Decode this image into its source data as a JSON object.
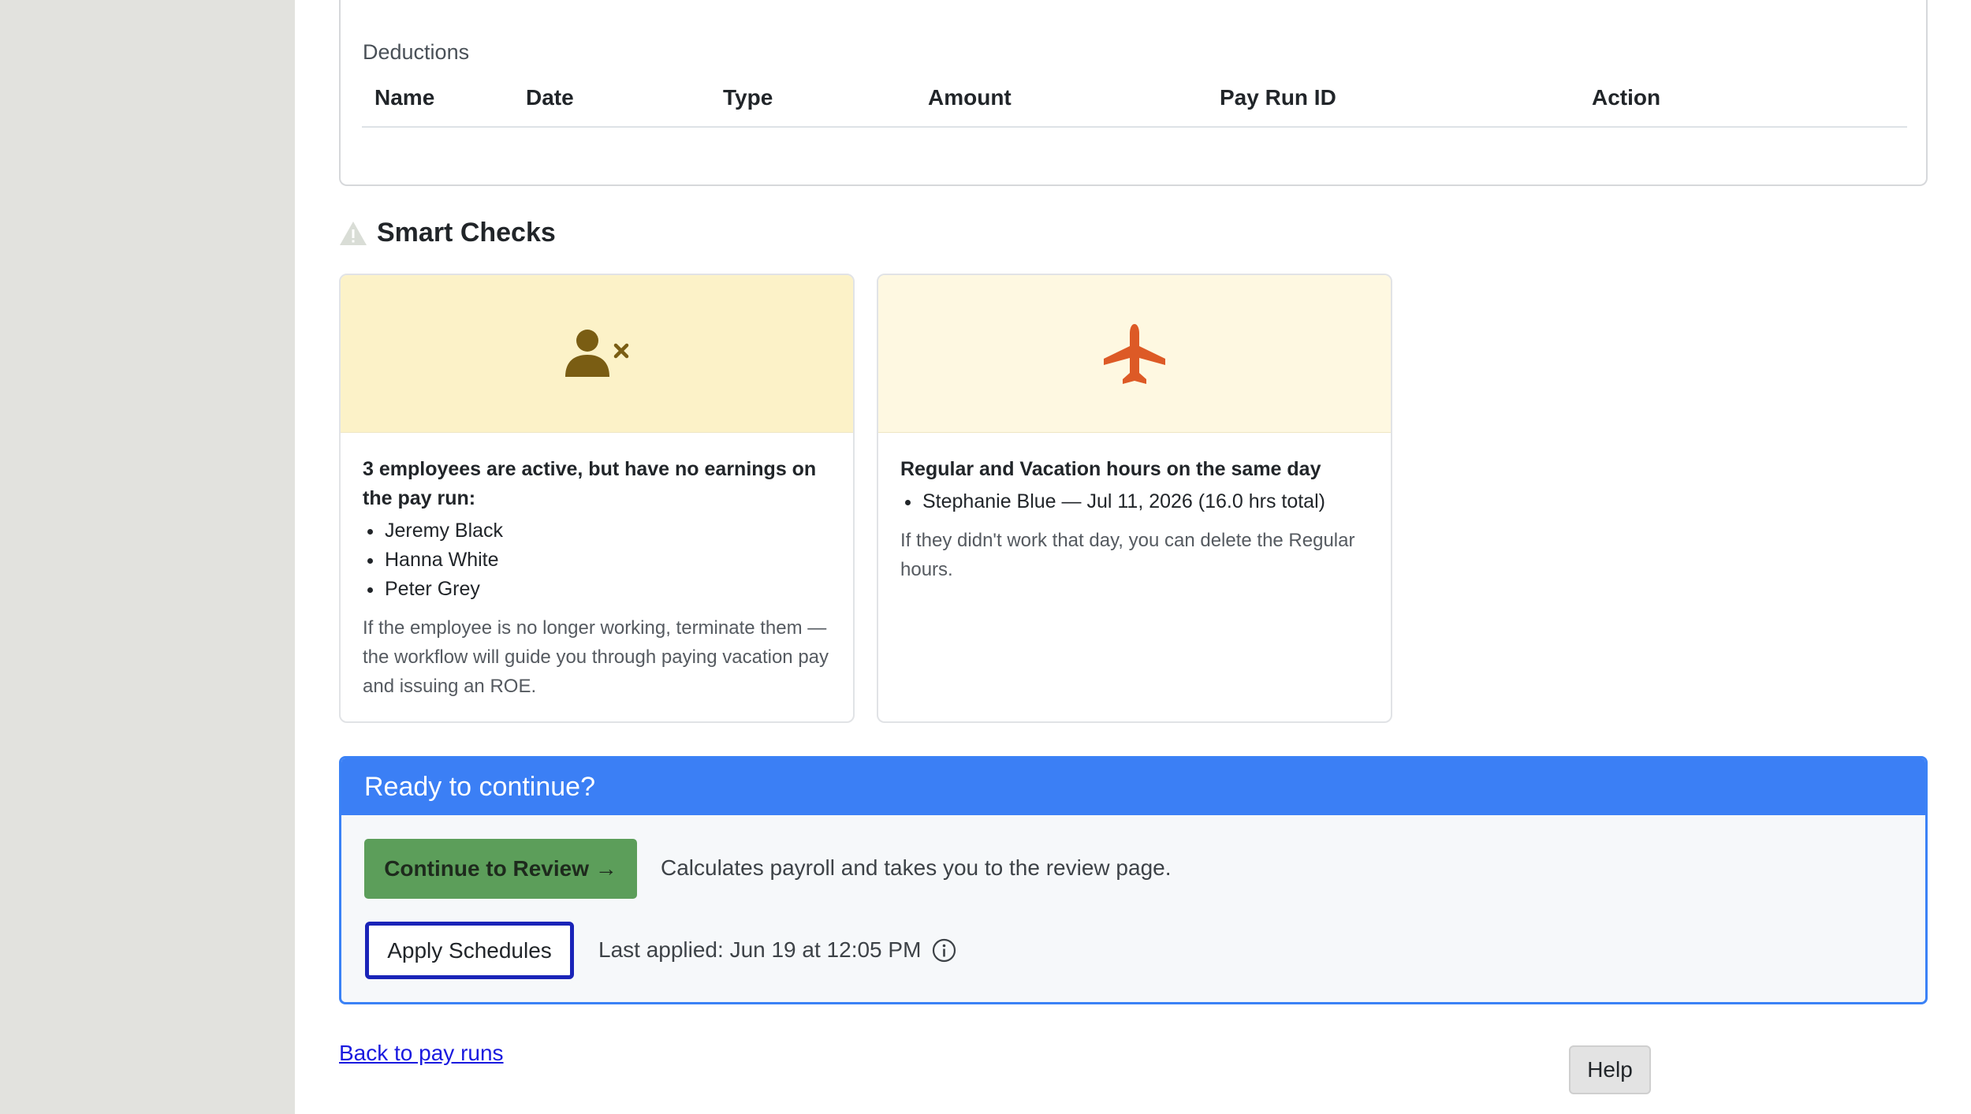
{
  "deductions": {
    "section_label": "Deductions",
    "columns": [
      "Name",
      "Date",
      "Type",
      "Amount",
      "Pay Run ID",
      "Action"
    ]
  },
  "smart_checks": {
    "title": "Smart Checks",
    "cards": [
      {
        "icon": "user-remove-icon",
        "headline": "3 employees are active, but have no earnings on the pay run:",
        "items": [
          "Jeremy Black",
          "Hanna White",
          "Peter Grey"
        ],
        "note": "If the employee is no longer working, terminate them — the workflow will guide you through paying vacation pay and issuing an ROE."
      },
      {
        "icon": "airplane-icon",
        "headline": "Regular and Vacation hours on the same day",
        "items": [
          "Stephanie Blue — Jul 11, 2026 (16.0 hrs total)"
        ],
        "note": "If they didn't work that day, you can delete the Regular hours."
      }
    ]
  },
  "ready": {
    "title": "Ready to continue?",
    "continue_label": "Continue to Review →",
    "continue_description": "Calculates payroll and takes you to the review page.",
    "apply_label": "Apply Schedules",
    "last_applied": "Last applied: Jun 19 at 12:05 PM"
  },
  "back_link": "Back to pay runs",
  "help_label": "Help",
  "colors": {
    "accent_blue": "#3b7ff5",
    "continue_green": "#5c9e5a",
    "focus_outline": "#1a24b8",
    "warning_banner": "#fcf2c8",
    "airplane": "#dd5a26",
    "user_icon": "#7a5d13"
  }
}
